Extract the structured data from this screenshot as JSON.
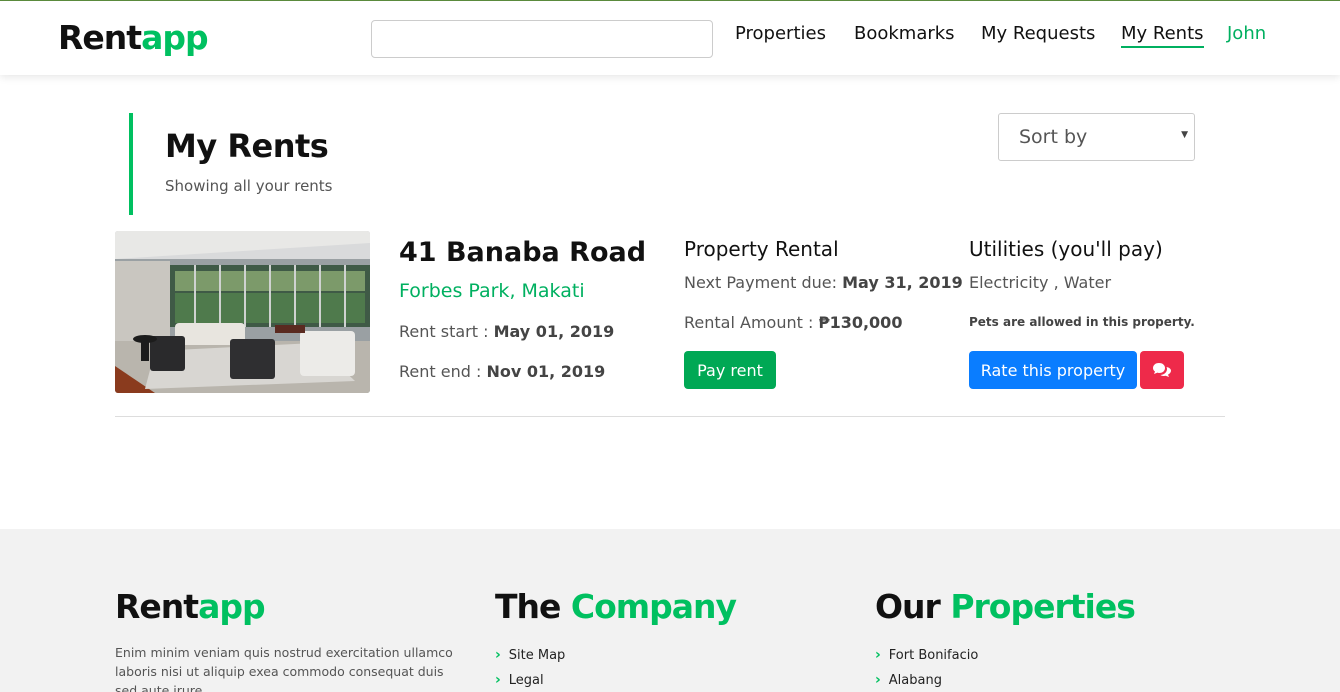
{
  "brand": {
    "part1": "Rent",
    "part2": "app"
  },
  "search": {
    "placeholder": "",
    "value": ""
  },
  "nav": {
    "properties": "Properties",
    "bookmarks": "Bookmarks",
    "requests": "My Requests",
    "rents": "My Rents",
    "user": "John"
  },
  "page": {
    "title": "My Rents",
    "subtitle": "Showing all your rents"
  },
  "sort": {
    "label": "Sort by"
  },
  "rent": {
    "address": "41 Banaba Road",
    "location": "Forbes Park, Makati",
    "start_label": "Rent start :",
    "start_value": "May 01, 2019",
    "end_label": "Rent end :",
    "end_value": "Nov 01, 2019",
    "payment_title": "Property Rental",
    "next_due_label": "Next Payment due:",
    "next_due_value": "May 31, 2019",
    "amount_label": "Rental Amount :",
    "amount_value": "₱130,000",
    "pay_button": "Pay rent",
    "utilities_title": "Utilities (you'll pay)",
    "utilities": "Electricity , Water",
    "pets_note": "Pets are allowed in this property.",
    "rate_button": "Rate this property",
    "chat_icon": "comments-icon"
  },
  "footer": {
    "brand_part1": "Rent",
    "brand_part2": "app",
    "about": "Enim minim veniam quis nostrud exercitation ullamco laboris nisi ut aliquip exea commodo consequat duis sed aute irure",
    "company_part1": "The",
    "company_part2": "Company",
    "company_links": [
      "Site Map",
      "Legal"
    ],
    "properties_part1": "Our",
    "properties_part2": "Properties",
    "property_links": [
      "Fort Bonifacio",
      "Alabang"
    ]
  },
  "colors": {
    "accent": "#00c060",
    "pay_button": "#00a854",
    "rate_button": "#0a7dff",
    "chat_button": "#ee2a4a"
  }
}
